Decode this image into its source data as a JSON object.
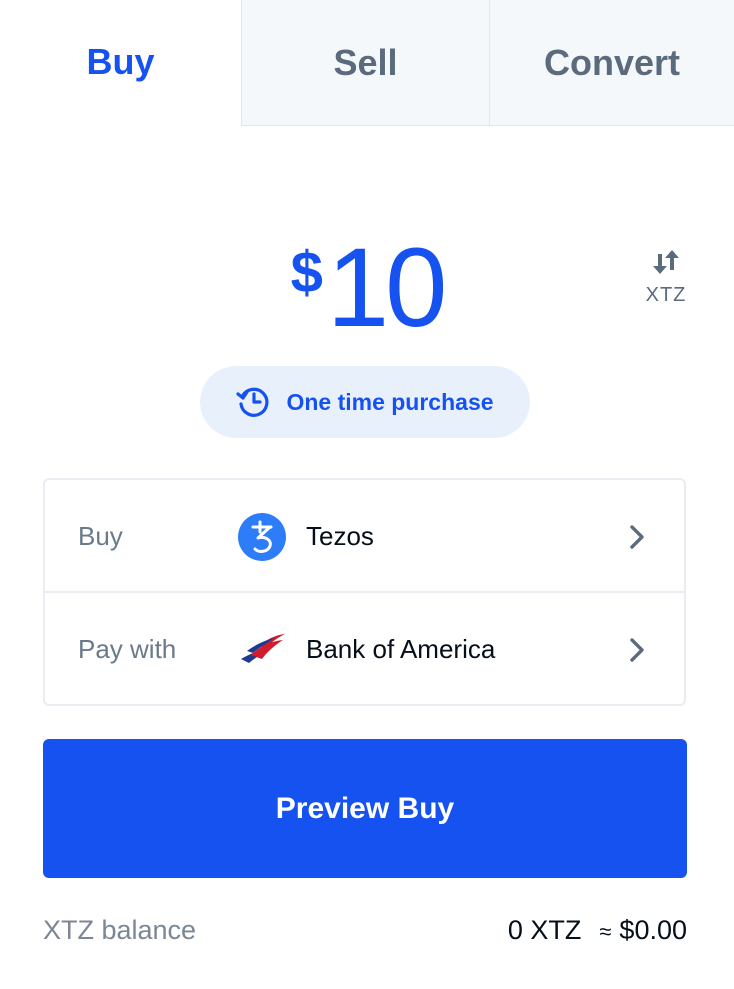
{
  "tabs": {
    "buy": "Buy",
    "sell": "Sell",
    "convert": "Convert"
  },
  "amount": {
    "currency_symbol": "$",
    "value": "10"
  },
  "swap": {
    "icon": "swap-arrows-icon",
    "label": "XTZ"
  },
  "frequency": {
    "icon": "history-clock-icon",
    "label": "One time purchase"
  },
  "asset_row": {
    "label": "Buy",
    "icon": "tezos-icon",
    "value": "Tezos"
  },
  "payment_row": {
    "label": "Pay with",
    "icon": "bank-of-america-logo",
    "value": "Bank of America"
  },
  "primary_button": {
    "label": "Preview Buy"
  },
  "balance": {
    "label": "XTZ balance",
    "amount": "0 XTZ",
    "approx_symbol": "≈",
    "fiat": "$0.00"
  },
  "colors": {
    "accent": "#1652f0",
    "muted": "#5b6b7d",
    "pill_bg": "#e8f1fb",
    "tab_inactive_bg": "#f5f8fa"
  }
}
